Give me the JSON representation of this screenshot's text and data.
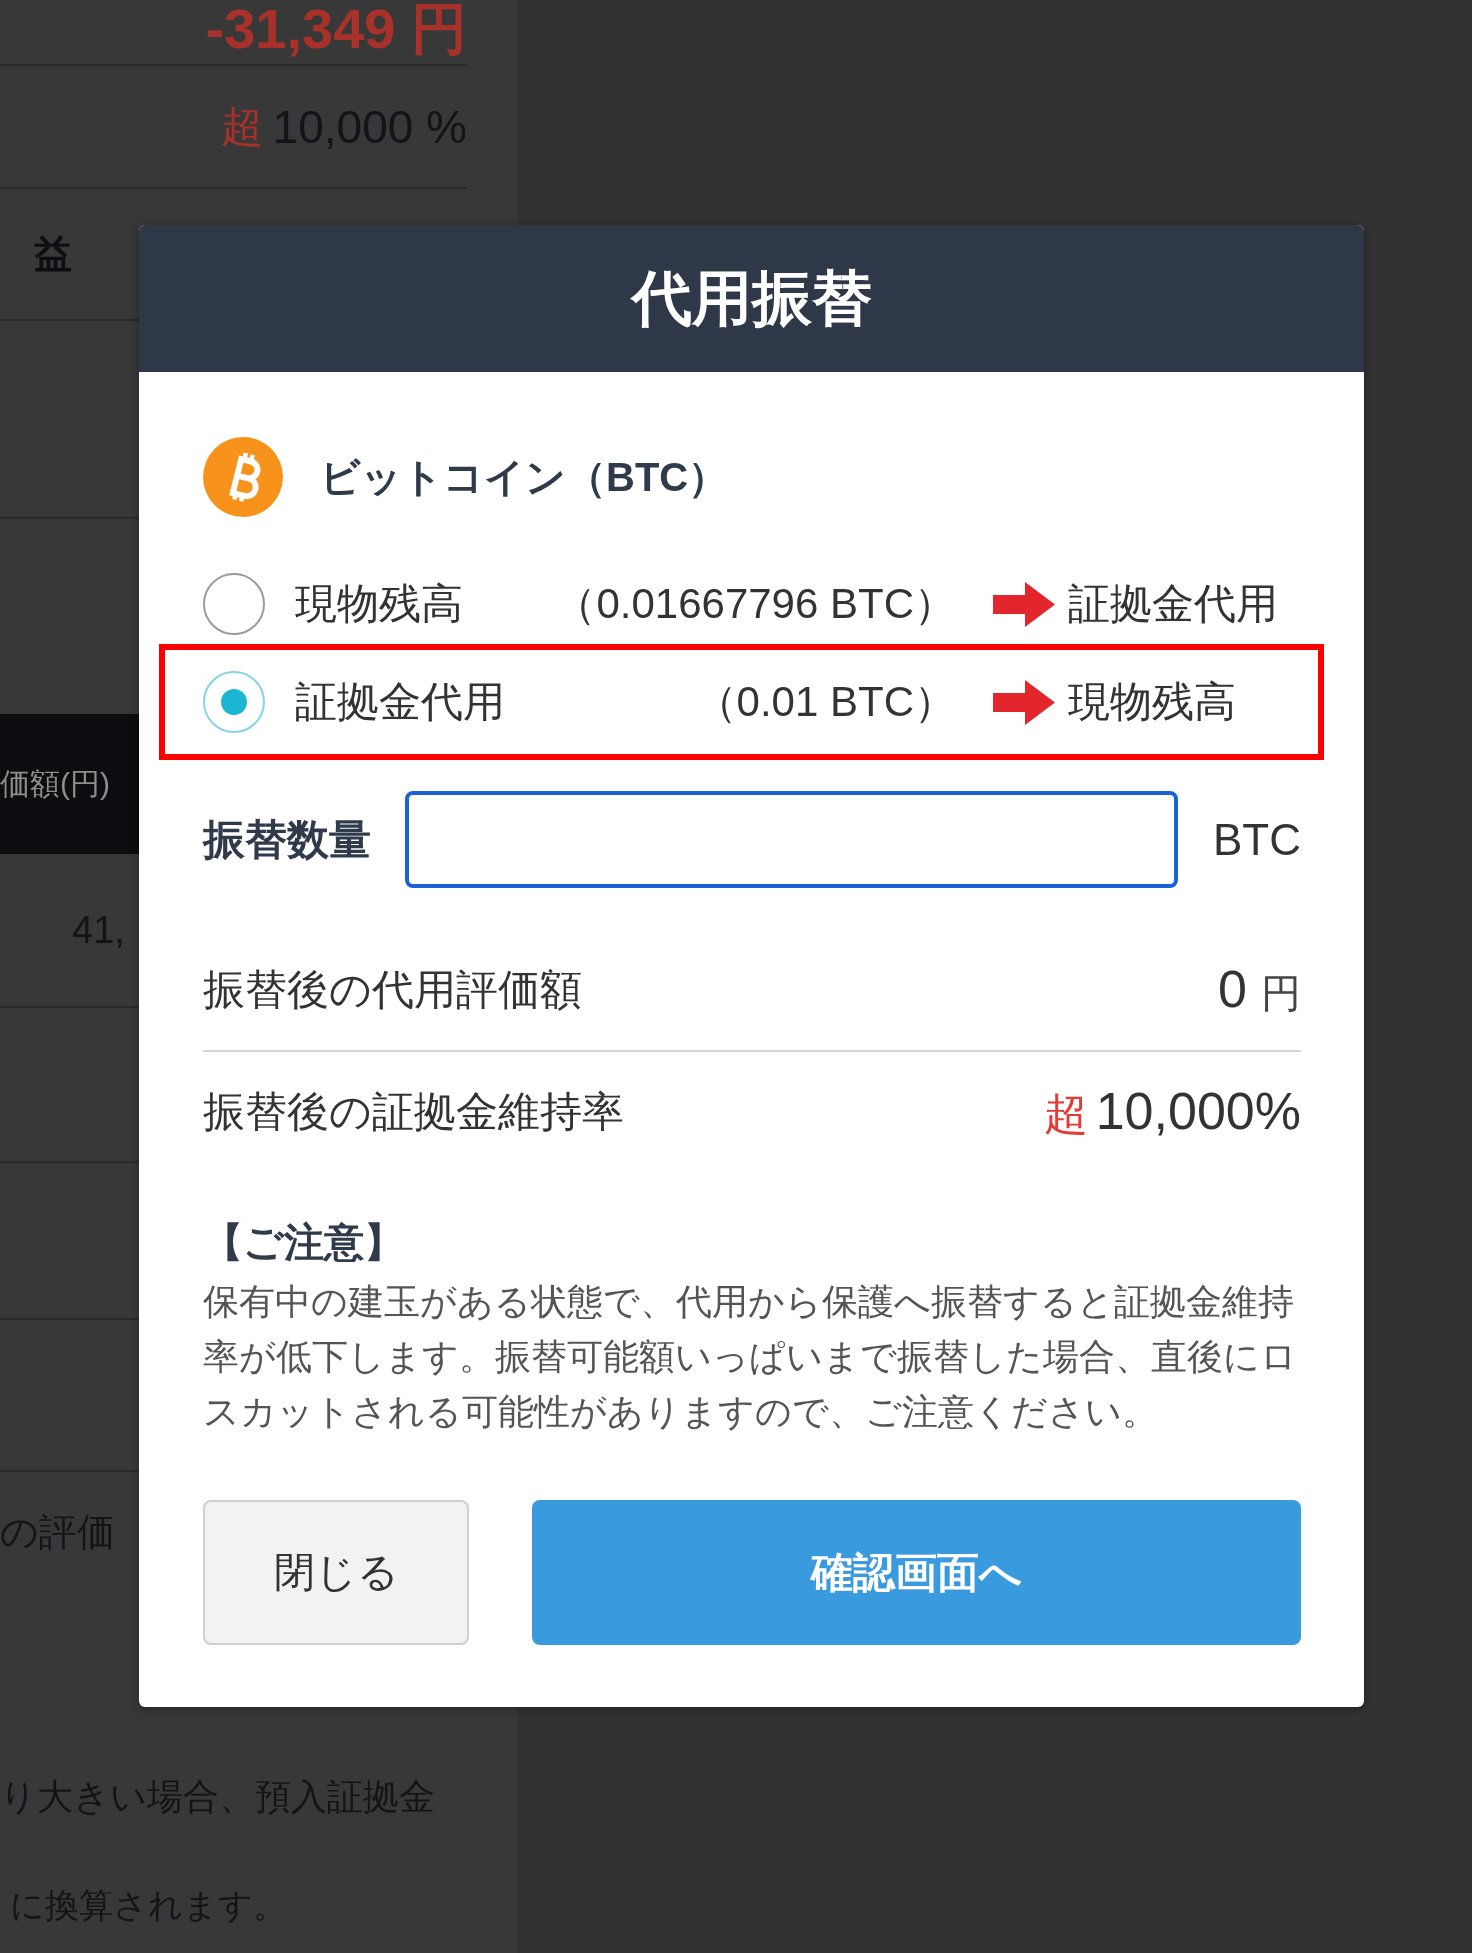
{
  "background": {
    "balance": "-31,349 円",
    "rate": {
      "prefix": "超",
      "value": "10,000 %"
    },
    "section_heading": "益",
    "table": {
      "column_header": "価額(円)",
      "cell": "41,"
    },
    "row_label": "の評価",
    "note_lines": [
      "り大きい場合、預入証拠金",
      "に換算されます。"
    ]
  },
  "dialog": {
    "title": "代用振替",
    "asset": {
      "name": "ビットコイン（BTC）"
    },
    "options": [
      {
        "label": "現物残高",
        "amount": "（0.01667796 BTC）",
        "target": "証拠金代用",
        "selected": false,
        "highlighted": false
      },
      {
        "label": "証拠金代用",
        "amount": "（0.01 BTC）",
        "target": "現物残高",
        "selected": true,
        "highlighted": true
      }
    ],
    "quantity": {
      "label": "振替数量",
      "unit": "BTC",
      "focused": true
    },
    "results": [
      {
        "label": "振替後の代用評価額",
        "value": "0",
        "unit": "円"
      },
      {
        "label": "振替後の証拠金維持率",
        "prefix": "超",
        "value": "10,000%"
      }
    ],
    "notice": {
      "heading": "【ご注意】",
      "text": "保有中の建玉がある状態で、代用から保護へ振替すると証拠金維持率が低下します。振替可能額いっぱいまで振替した場合、直後にロスカットされる可能性がありますので、ご注意ください。"
    },
    "buttons": [
      {
        "label": "閉じる",
        "kind": "secondary"
      },
      {
        "label": "確認画面へ",
        "kind": "primary"
      }
    ]
  }
}
